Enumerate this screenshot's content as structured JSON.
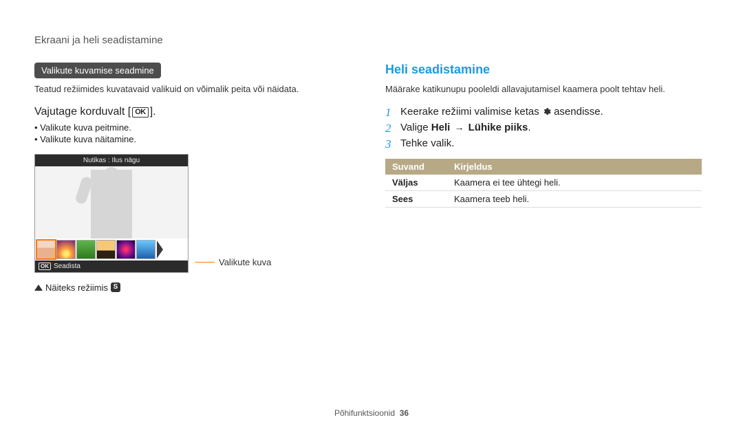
{
  "header": {
    "breadcrumb": "Ekraani ja heli seadistamine"
  },
  "left": {
    "pill_label": "Valikute kuvamise seadmine",
    "intro": "Teatud režiimides kuvatavaid valikuid on võimalik peita või näidata.",
    "press_prefix": "Vajutage korduvalt [",
    "press_ok": "OK",
    "press_suffix": "].",
    "bullets": [
      "Valikute kuva peitmine.",
      "Valikute kuva näitamine."
    ],
    "cam": {
      "titlebar": "Nutikas : Ilus nägu",
      "footer_ok": "OK",
      "footer_label": "Seadista"
    },
    "callout_label": "Valikute kuva",
    "note_text": "Näiteks režiimis",
    "note_badge": "S"
  },
  "right": {
    "section_title": "Heli seadistamine",
    "intro": "Määrake katikunupu pooleldi allavajutamisel kaamera poolt tehtav heli.",
    "steps": {
      "1_prefix": "Keerake režiimi valimise ketas ",
      "1_suffix": " asendisse.",
      "2_prefix": "Valige ",
      "2_bold1": "Heli",
      "2_arrow": "→",
      "2_bold2": "Lühike piiks",
      "2_suffix": ".",
      "3": "Tehke valik."
    },
    "table": {
      "head_option": "Suvand",
      "head_desc": "Kirjeldus",
      "rows": [
        {
          "name": "Väljas",
          "desc": "Kaamera ei tee ühtegi heli."
        },
        {
          "name": "Sees",
          "desc": "Kaamera teeb heli."
        }
      ]
    }
  },
  "footer": {
    "section": "Põhifunktsioonid",
    "page": "36"
  }
}
